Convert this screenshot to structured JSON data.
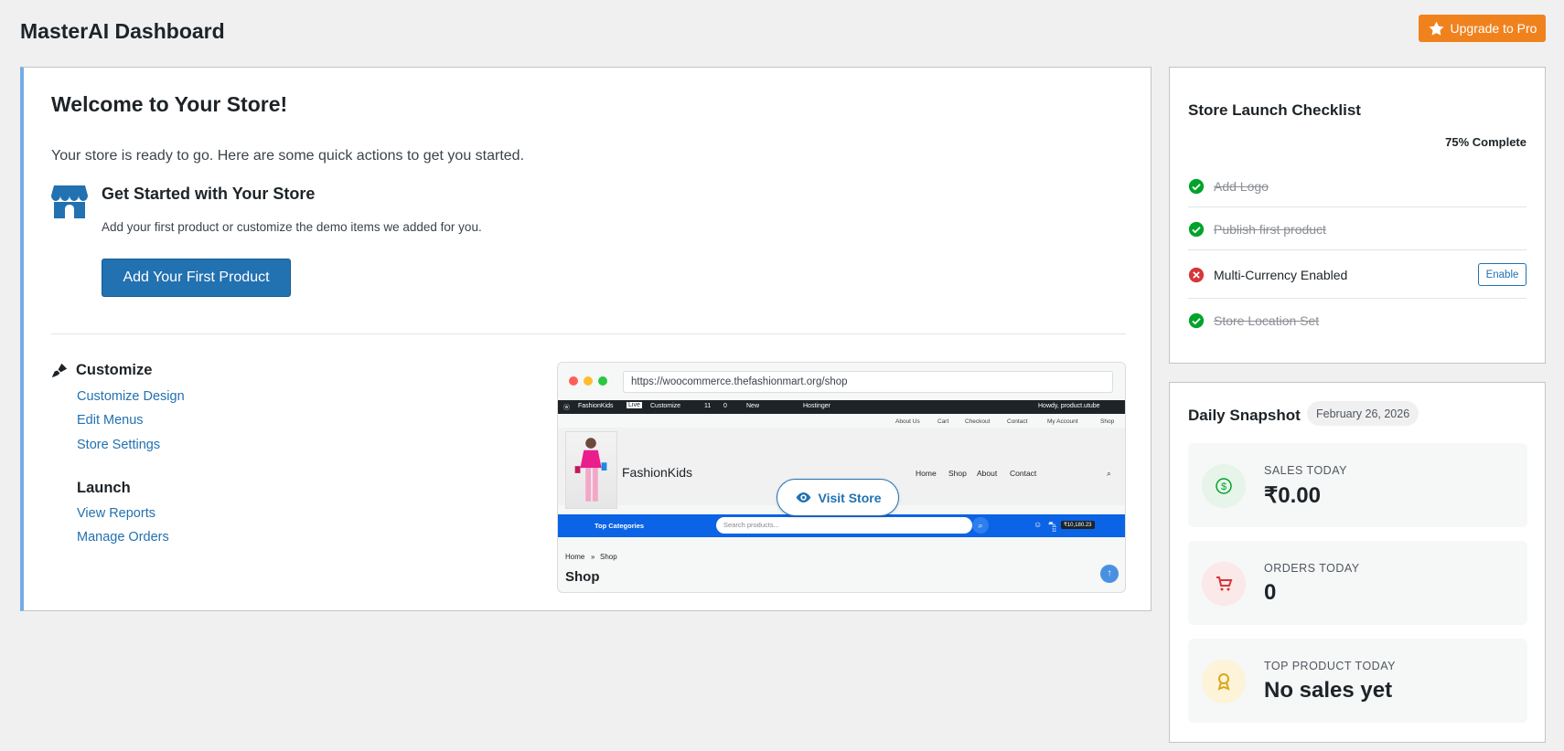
{
  "header": {
    "title": "MasterAI Dashboard",
    "upgrade_label": "Upgrade to Pro"
  },
  "welcome": {
    "title": "Welcome to Your Store!",
    "intro": "Your store is ready to go. Here are some quick actions to get you started.",
    "get_started_title": "Get Started with Your Store",
    "get_started_desc": "Add your first product or customize the demo items we added for you.",
    "primary_button": "Add Your First Product",
    "customize": {
      "heading": "Customize",
      "links": [
        "Customize Design",
        "Edit Menus",
        "Store Settings"
      ]
    },
    "launch": {
      "heading": "Launch",
      "links": [
        "View Reports",
        "Manage Orders"
      ]
    }
  },
  "preview": {
    "url": "https://woocommerce.thefashionmart.org/shop",
    "admin_bar": {
      "site": "FashionKids",
      "live": "Live",
      "customize": "Customize",
      "updates": "11",
      "comments": "0",
      "new": "New",
      "hostinger": "Hostinger",
      "howdy": "Howdy, product.utube"
    },
    "top_nav": [
      "About Us",
      "Cart",
      "Checkout",
      "Contact",
      "My Account",
      "Shop"
    ],
    "site_name": "FashionKids",
    "site_menu": [
      "Home",
      "Shop",
      "About",
      "Contact"
    ],
    "categories_label": "Top Categories",
    "search_placeholder": "Search products...",
    "cart_count": "11",
    "cart_total": "₹10,180.23",
    "breadcrumb_home": "Home",
    "breadcrumb_sep": "»",
    "breadcrumb_current": "Shop",
    "page_heading": "Shop",
    "visit_label": "Visit Store"
  },
  "checklist": {
    "title": "Store Launch Checklist",
    "progress_text": "75% Complete",
    "progress": 0.75,
    "items": [
      {
        "label": "Add Logo",
        "done": true
      },
      {
        "label": "Publish first product",
        "done": true
      },
      {
        "label": "Multi-Currency Enabled",
        "done": false,
        "action": "Enable"
      },
      {
        "label": "Store Location Set",
        "done": true
      }
    ]
  },
  "snapshot": {
    "title": "Daily Snapshot",
    "date": "February 26, 2026",
    "stats": [
      {
        "label": "SALES TODAY",
        "value": "₹0.00",
        "icon": "dollar-icon",
        "color": "#00a32a"
      },
      {
        "label": "ORDERS TODAY",
        "value": "0",
        "icon": "cart-icon",
        "color": "#d63638"
      },
      {
        "label": "TOP PRODUCT TODAY",
        "value": "No sales yet",
        "icon": "award-icon",
        "color": "#dba617"
      }
    ]
  },
  "colors": {
    "accent": "#2271b1",
    "upgrade": "#f0821e",
    "success": "#00a32a",
    "error": "#d63638",
    "border_left": "#72aee6"
  }
}
